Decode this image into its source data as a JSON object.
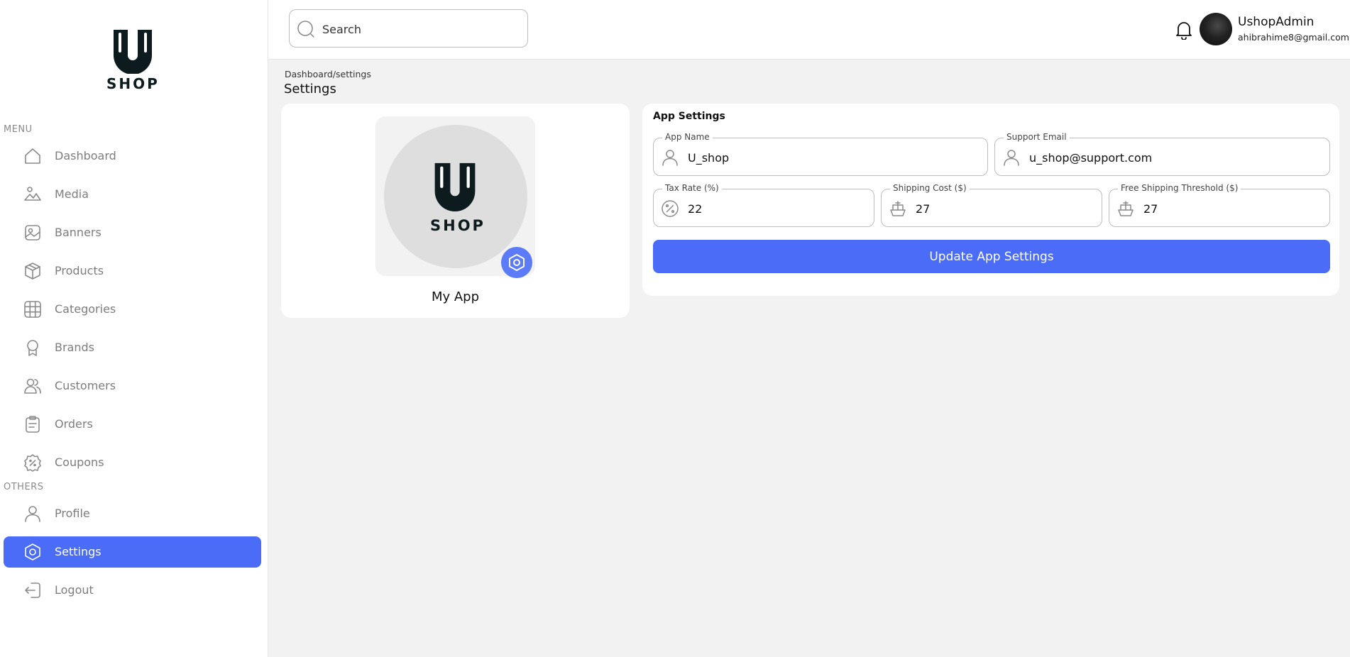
{
  "brand": {
    "logo_letter": "U",
    "logo_text": "SHOP",
    "accent": "#4a6cf7"
  },
  "sidebar": {
    "menu_label": "MENU",
    "others_label": "OTHERS",
    "items": [
      {
        "label": "Dashboard",
        "icon": "home-icon"
      },
      {
        "label": "Media",
        "icon": "media-icon"
      },
      {
        "label": "Banners",
        "icon": "image-icon"
      },
      {
        "label": "Products",
        "icon": "box-icon"
      },
      {
        "label": "Categories",
        "icon": "grid-icon"
      },
      {
        "label": "Brands",
        "icon": "badge-icon"
      },
      {
        "label": "Customers",
        "icon": "users-icon"
      },
      {
        "label": "Orders",
        "icon": "clipboard-icon"
      },
      {
        "label": "Coupons",
        "icon": "coupon-icon"
      }
    ],
    "others": [
      {
        "label": "Profile",
        "icon": "user-icon"
      },
      {
        "label": "Settings",
        "icon": "settings-icon",
        "active": true
      },
      {
        "label": "Logout",
        "icon": "logout-icon"
      }
    ]
  },
  "header": {
    "search_placeholder": "Search",
    "user_name": "UshopAdmin",
    "user_email": "ahibrahime8@gmail.com"
  },
  "page": {
    "breadcrumb": "Dashboard/settings",
    "title": "Settings"
  },
  "app_card": {
    "name": "My App",
    "logo_text": "SHOP"
  },
  "app_settings": {
    "title": "App Settings",
    "app_name_label": "App Name",
    "app_name_value": "U_shop",
    "support_email_label": "Support Email",
    "support_email_value": "u_shop@support.com",
    "tax_rate_label": "Tax Rate (%)",
    "tax_rate_value": "22",
    "shipping_cost_label": "Shipping Cost ($)",
    "shipping_cost_value": "27",
    "free_shipping_label": "Free Shipping Threshold ($)",
    "free_shipping_value": "27",
    "update_button": "Update App Settings"
  }
}
